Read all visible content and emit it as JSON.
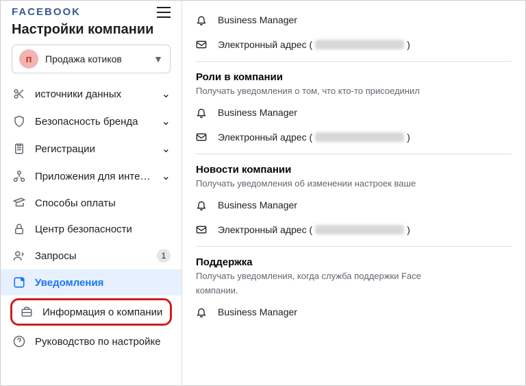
{
  "header": {
    "logo": "FACEBOOK",
    "title": "Настройки компании"
  },
  "company": {
    "avatar_letter": "п",
    "name": "Продажа котиков"
  },
  "sidebar": {
    "items": [
      {
        "label": "источники данных",
        "icon": "scissors",
        "expandable": true
      },
      {
        "label": "Безопасность бренда",
        "icon": "shield",
        "expandable": true
      },
      {
        "label": "Регистрации",
        "icon": "clipboard",
        "expandable": true
      },
      {
        "label": "Приложения для интег…",
        "icon": "integration",
        "expandable": true
      },
      {
        "label": "Способы оплаты",
        "icon": "card",
        "expandable": false
      },
      {
        "label": "Центр безопасности",
        "icon": "lock",
        "expandable": false
      },
      {
        "label": "Запросы",
        "icon": "requests",
        "expandable": false,
        "badge": "1"
      },
      {
        "label": "Уведомления",
        "icon": "notifications-box",
        "expandable": false,
        "active": true
      },
      {
        "label": "Информация о компании",
        "icon": "briefcase",
        "expandable": false,
        "highlighted": true
      },
      {
        "label": "Руководство по настройке",
        "icon": "help",
        "expandable": false
      }
    ]
  },
  "content": {
    "business_manager_label": "Business Manager",
    "email_label": "Электронный адрес (",
    "email_close": ")",
    "sections": [
      {
        "title": "Роли в компании",
        "subtitle": "Получать уведомления о том, что кто-то присоединил"
      },
      {
        "title": "Новости компании",
        "subtitle": "Получать уведомления об изменении настроек ваше"
      },
      {
        "title": "Поддержка",
        "subtitle": "Получать уведомления, когда служба поддержки Face",
        "subtitle2": "компании."
      }
    ]
  }
}
